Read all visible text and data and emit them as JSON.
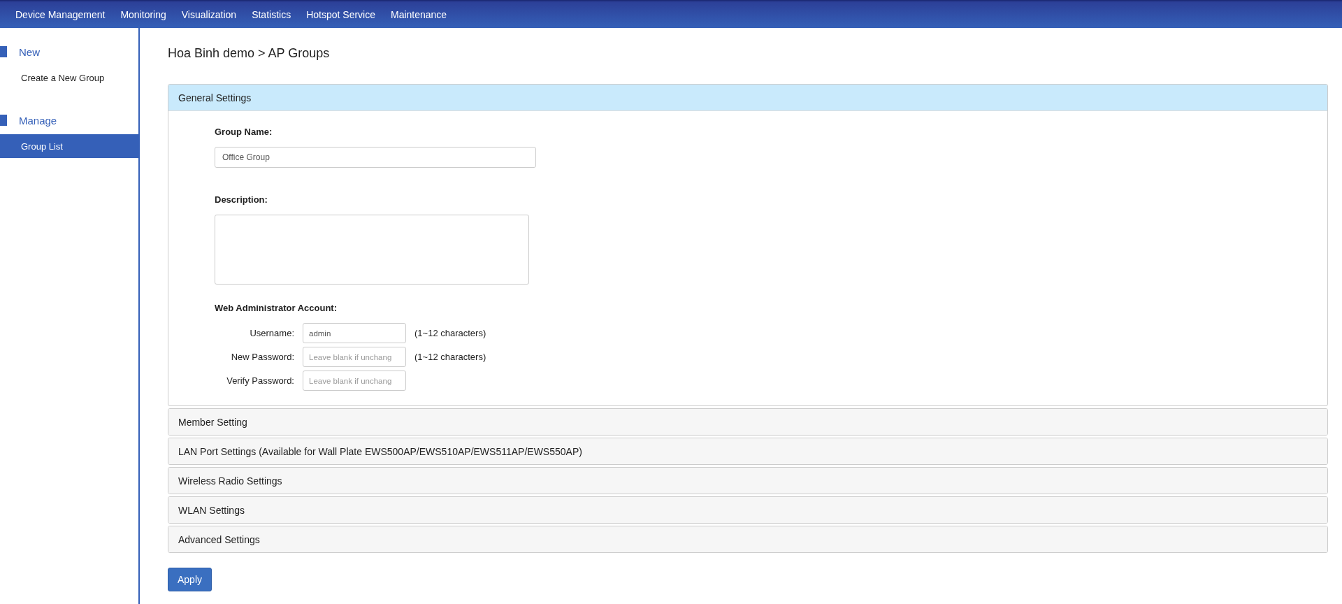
{
  "nav": {
    "items": [
      {
        "label": "Device Management"
      },
      {
        "label": "Monitoring"
      },
      {
        "label": "Visualization"
      },
      {
        "label": "Statistics"
      },
      {
        "label": "Hotspot Service"
      },
      {
        "label": "Maintenance"
      }
    ]
  },
  "sidebar": {
    "sections": [
      {
        "title": "New",
        "items": [
          {
            "label": "Create a New Group",
            "selected": false
          }
        ]
      },
      {
        "title": "Manage",
        "items": [
          {
            "label": "Group List",
            "selected": true
          }
        ]
      }
    ]
  },
  "breadcrumb": "Hoa Binh demo > AP Groups",
  "panels": [
    {
      "title": "General Settings",
      "expanded": true
    },
    {
      "title": "Member Setting",
      "expanded": false
    },
    {
      "title": "LAN Port Settings (Available for Wall Plate EWS500AP/EWS510AP/EWS511AP/EWS550AP)",
      "expanded": false
    },
    {
      "title": "Wireless Radio Settings",
      "expanded": false
    },
    {
      "title": "WLAN Settings",
      "expanded": false
    },
    {
      "title": "Advanced Settings",
      "expanded": false
    }
  ],
  "general": {
    "group_name": {
      "label": "Group Name:",
      "value": "Office Group"
    },
    "description": {
      "label": "Description:"
    },
    "account": {
      "title": "Web Administrator Account:",
      "rows": [
        {
          "label": "Username:",
          "value": "admin",
          "hint": "(1~12 characters)"
        },
        {
          "label": "New Password:",
          "placeholder": "Leave blank if unchang",
          "hint": "(1~12 characters)"
        },
        {
          "label": "Verify Password:",
          "placeholder": "Leave blank if unchang"
        }
      ]
    }
  },
  "apply_button": "Apply"
}
